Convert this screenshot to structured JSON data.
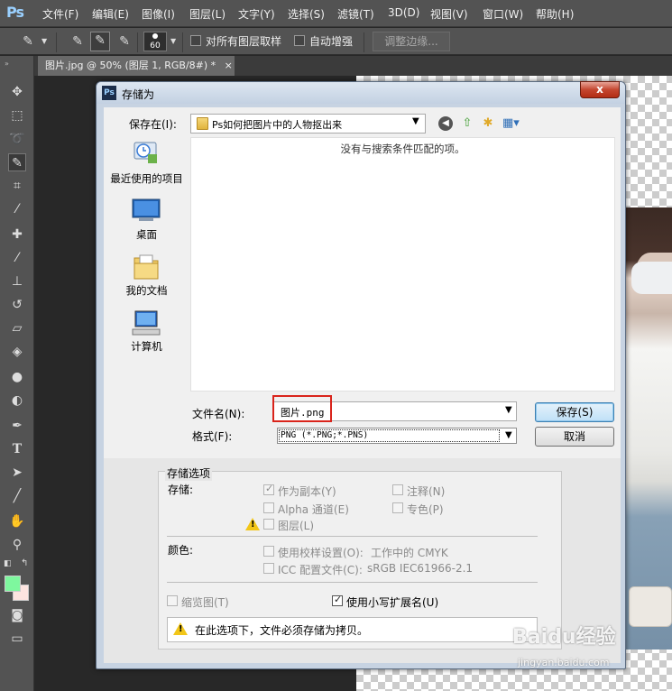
{
  "app": {
    "logo": "Ps",
    "menu": [
      "文件(F)",
      "编辑(E)",
      "图像(I)",
      "图层(L)",
      "文字(Y)",
      "选择(S)",
      "滤镜(T)",
      "3D(D)",
      "视图(V)",
      "窗口(W)",
      "帮助(H)"
    ]
  },
  "options_bar": {
    "brush_size": "60",
    "sample_all_layers_label": "对所有图层取样",
    "auto_enhance_label": "自动增强",
    "refine_edge_label": "调整边缘..."
  },
  "document_tab": {
    "title": "图片.jpg @ 50% (图层 1, RGB/8#) *",
    "close": "×"
  },
  "dialog": {
    "title": "存储为",
    "icon": "Ps",
    "close": "x",
    "save_in_label": "保存在(I):",
    "save_in_value": "Ps如何把图片中的人物抠出来",
    "empty_message": "没有与搜索条件匹配的项。",
    "places": [
      {
        "label": "最近使用的项目",
        "icon": "recent-items-icon"
      },
      {
        "label": "桌面",
        "icon": "desktop-icon"
      },
      {
        "label": "我的文档",
        "icon": "my-documents-icon"
      },
      {
        "label": "计算机",
        "icon": "computer-icon"
      }
    ],
    "filename_label": "文件名(N):",
    "filename_value": "图片.png",
    "format_label": "格式(F):",
    "format_value": "PNG (*.PNG;*.PNS)",
    "save_button": "保存(S)",
    "cancel_button": "取消"
  },
  "save_options": {
    "group_title": "存储选项",
    "storage_label": "存储:",
    "as_copy": {
      "label": "作为副本(Y)",
      "checked": true
    },
    "alpha": {
      "label": "Alpha 通道(E)",
      "checked": false
    },
    "layers": {
      "label": "图层(L)",
      "checked": false
    },
    "notes": {
      "label": "注释(N)",
      "checked": false
    },
    "spot": {
      "label": "专色(P)",
      "checked": false
    },
    "color_label": "颜色:",
    "proof": {
      "label": "使用校样设置(O):",
      "suffix": "工作中的 CMYK",
      "checked": false
    },
    "icc": {
      "label": "ICC 配置文件(C):",
      "suffix": "sRGB IEC61966-2.1",
      "checked": false
    },
    "thumbnail": {
      "label": "缩览图(T)",
      "checked": false
    },
    "lowercase_ext": {
      "label": "使用小写扩展名(U)",
      "checked": true
    },
    "warning": "在此选项下，文件必须存储为拷贝。"
  },
  "watermark": {
    "brand": "Baidu经验",
    "url": "jingyan.baidu.com"
  },
  "colors": {
    "foreground": "#7ef79e",
    "background": "#fde4e0",
    "highlight_box": "#d9241b"
  }
}
